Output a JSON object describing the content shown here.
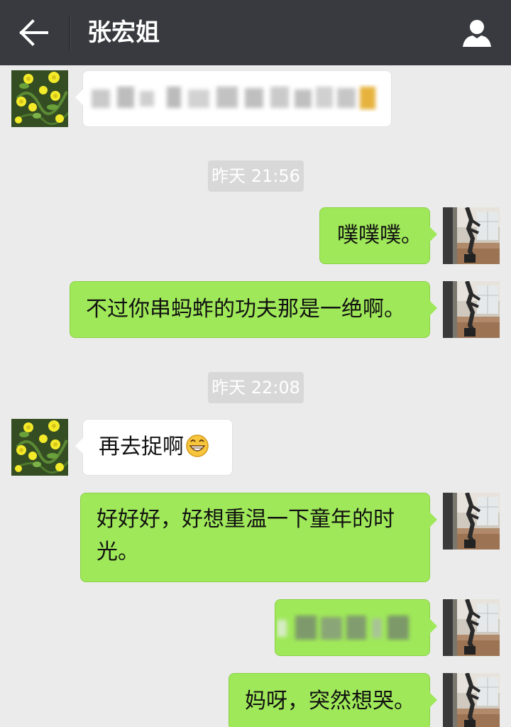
{
  "header": {
    "title": "张宏姐",
    "back_icon": "arrow-left-icon",
    "profile_icon": "person-icon"
  },
  "colors": {
    "topbar": "#393a3f",
    "background": "#ebebeb",
    "sent_bubble": "#9fe859",
    "received_bubble": "#ffffff",
    "time_pill": "#d8d8d8"
  },
  "messages": [
    {
      "side": "received",
      "text": "",
      "blurred": true
    },
    {
      "type": "time",
      "text": "昨天 21:56"
    },
    {
      "side": "sent",
      "text": "噗噗噗。"
    },
    {
      "side": "sent",
      "text": "不过你串蚂蚱的功夫那是一绝啊。"
    },
    {
      "type": "time",
      "text": "昨天 22:08"
    },
    {
      "side": "received",
      "text": "再去捉啊",
      "emoji": "grinning-face-icon"
    },
    {
      "side": "sent",
      "text": "好好好，好想重温一下童年的时光。"
    },
    {
      "side": "sent",
      "text": "",
      "blurred": true
    },
    {
      "side": "sent",
      "text": "妈呀，突然想哭。"
    }
  ]
}
